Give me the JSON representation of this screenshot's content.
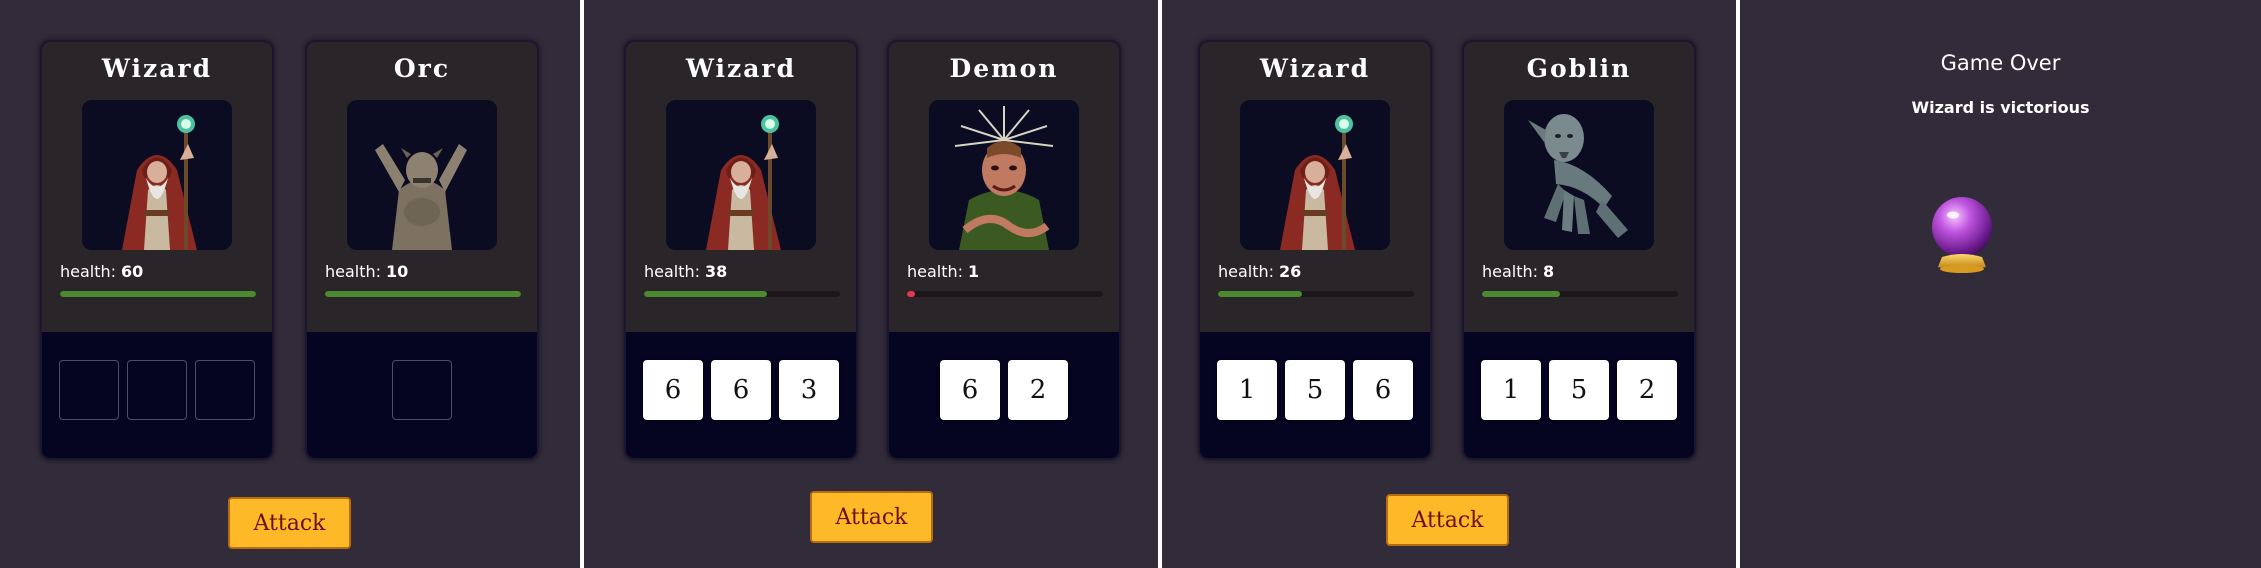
{
  "screens": [
    {
      "hero": {
        "name": "Wizard",
        "portrait": "wizard-portrait",
        "health_label": "health:",
        "health_value": "60",
        "health_fraction": 1.0,
        "dice": [
          "",
          "",
          ""
        ]
      },
      "monster": {
        "name": "Orc",
        "portrait": "orc-portrait",
        "health_label": "health:",
        "health_value": "10",
        "health_fraction": 1.0,
        "dice": [
          ""
        ]
      },
      "attack_label": "Attack"
    },
    {
      "hero": {
        "name": "Wizard",
        "portrait": "wizard-portrait",
        "health_label": "health:",
        "health_value": "38",
        "health_fraction": 0.63,
        "dice": [
          "6",
          "6",
          "3"
        ]
      },
      "monster": {
        "name": "Demon",
        "portrait": "demon-portrait",
        "health_label": "health:",
        "health_value": "1",
        "health_fraction": 0.04,
        "dice": [
          "6",
          "2"
        ]
      },
      "attack_label": "Attack"
    },
    {
      "hero": {
        "name": "Wizard",
        "portrait": "wizard-portrait",
        "health_label": "health:",
        "health_value": "26",
        "health_fraction": 0.43,
        "dice": [
          "1",
          "5",
          "6"
        ]
      },
      "monster": {
        "name": "Goblin",
        "portrait": "goblin-portrait",
        "health_label": "health:",
        "health_value": "8",
        "health_fraction": 0.4,
        "dice": [
          "1",
          "5",
          "2"
        ]
      },
      "attack_label": "Attack"
    }
  ],
  "game_over": {
    "title": "Game Over",
    "message": "Wizard is victorious",
    "icon": "crystal-ball-icon"
  },
  "colors": {
    "background": "#322b3a",
    "card_top": "#2a2529",
    "card_bottom": "#050522",
    "health_bar": "#4b8a2e",
    "health_bar_low": "#e5384e",
    "attack_button": "#fdb927",
    "attack_text": "#6b1010"
  }
}
